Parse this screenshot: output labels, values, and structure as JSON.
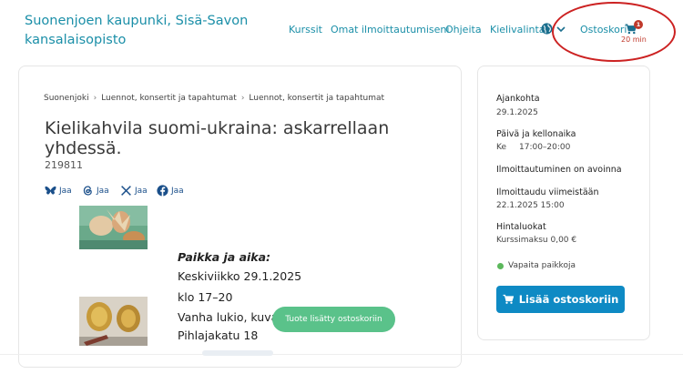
{
  "header": {
    "brand": "Suonenjoen kaupunki, Sisä-Savon kansalaisopisto",
    "nav": {
      "kurssit": "Kurssit",
      "omat": "Omat ilmoittautumiseni",
      "ohjeita": "Ohjeita",
      "kielivalinta": "Kielivalinta",
      "cart_label": "Ostoskori",
      "cart_count": "1",
      "cart_timer": "20 min"
    }
  },
  "breadcrumb": [
    "Suonenjoki",
    "Luennot, konsertit ja tapahtumat",
    "Luennot, konsertit ja tapahtumat"
  ],
  "course": {
    "title": "Kielikahvila suomi-ukraina: askarrellaan yhdessä.",
    "code": "219811"
  },
  "share": [
    {
      "icon": "bluesky-icon",
      "label": "Jaa"
    },
    {
      "icon": "threads-icon",
      "label": "Jaa"
    },
    {
      "icon": "x-icon",
      "label": "Jaa"
    },
    {
      "icon": "facebook-icon",
      "label": "Jaa"
    }
  ],
  "details": {
    "heading": "Paikka ja aika:",
    "lines": [
      "Keskiviikko 29.1.2025",
      "klo 17–20",
      "Vanha lukio, kuvat",
      "Pihlajakatu 18"
    ]
  },
  "toast": "Tuote lisätty ostoskoriin",
  "sidebar": {
    "ajankohta_label": "Ajankohta",
    "ajankohta_value": "29.1.2025",
    "paiva_label": "Päivä ja kellonaika",
    "paiva_day": "Ke",
    "paiva_time": "17:00–20:00",
    "status": "Ilmoittautuminen on avoinna",
    "deadline_label": "Ilmoittaudu viimeistään",
    "deadline_value": "22.1.2025 15:00",
    "price_label": "Hintaluokat",
    "price_value": "Kurssimaksu 0,00 €",
    "availability": "Vapaita paikkoja",
    "add_button": "Lisää ostoskoriin"
  },
  "colors": {
    "accent": "#1b8fa8",
    "button": "#0e8ac4",
    "toast": "#5ac28a",
    "badge": "#c0392b",
    "annotation": "#cc2222"
  }
}
